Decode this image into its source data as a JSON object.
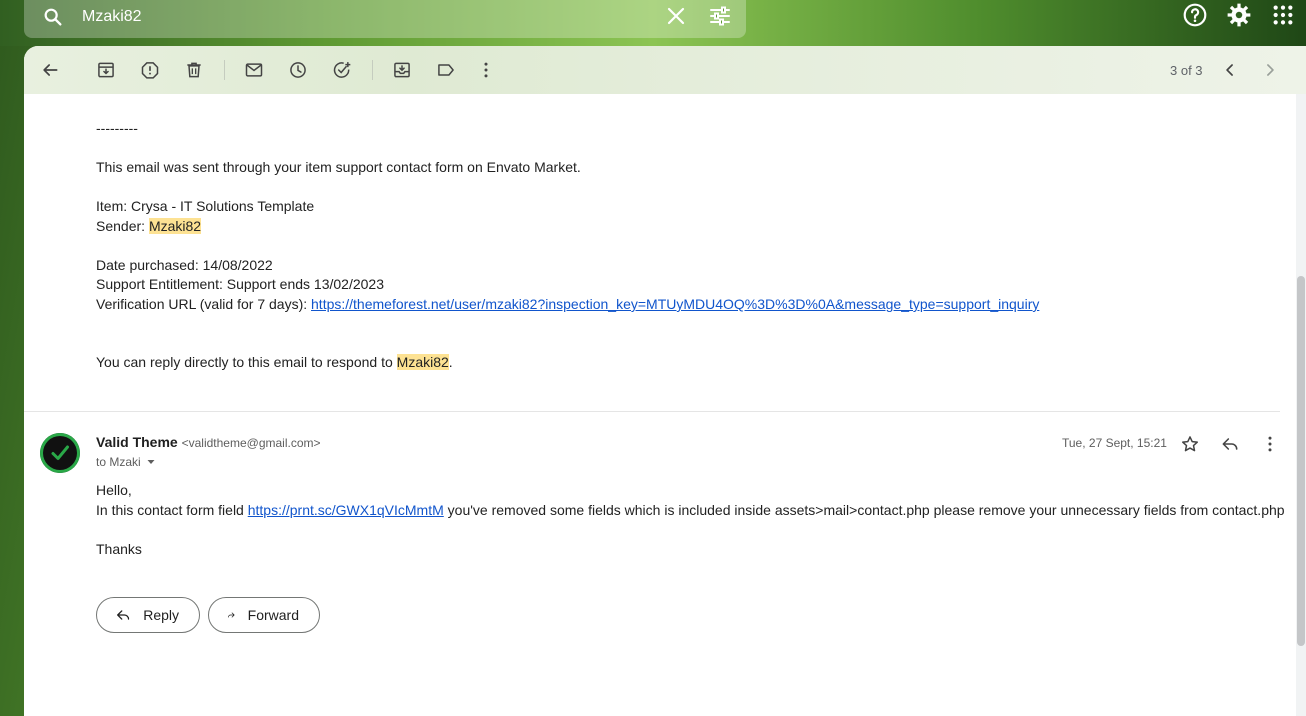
{
  "search": {
    "query": "Mzaki82"
  },
  "toolbar": {
    "counter": "3 of 3"
  },
  "prev_message": {
    "separator": "---------",
    "line_sent": "This email was sent through your item support contact form on Envato Market.",
    "item_label": "Item: Crysa - IT Solutions Template",
    "sender_label": "Sender: ",
    "sender_name": "Mzaki82",
    "date_purchased": "Date purchased: 14/08/2022",
    "support": "Support Entitlement: Support ends 13/02/2023",
    "verification_label": "Verification URL (valid for 7 days): ",
    "verification_url": "https://themeforest.net/user/mzaki82?inspection_key=MTUyMDU4OQ%3D%3D%0A&message_type=support_inquiry",
    "reply_prefix": "You can reply directly to this email to respond to ",
    "reply_name": "Mzaki82",
    "reply_suffix": "."
  },
  "message": {
    "sender_name": "Valid Theme",
    "sender_email": "<validtheme@gmail.com>",
    "to": "to Mzaki",
    "date": "Tue, 27 Sept, 15:21",
    "greeting": "Hello,",
    "body_prefix": "In this contact form field ",
    "body_link": "https://prnt.sc/GWX1qVIcMmtM",
    "body_suffix": " you've removed some fields which is included inside assets>mail>contact.php please remove your unnecessary fields from contact.php",
    "signoff": "Thanks"
  },
  "actions": {
    "reply": "Reply",
    "forward": "Forward"
  }
}
